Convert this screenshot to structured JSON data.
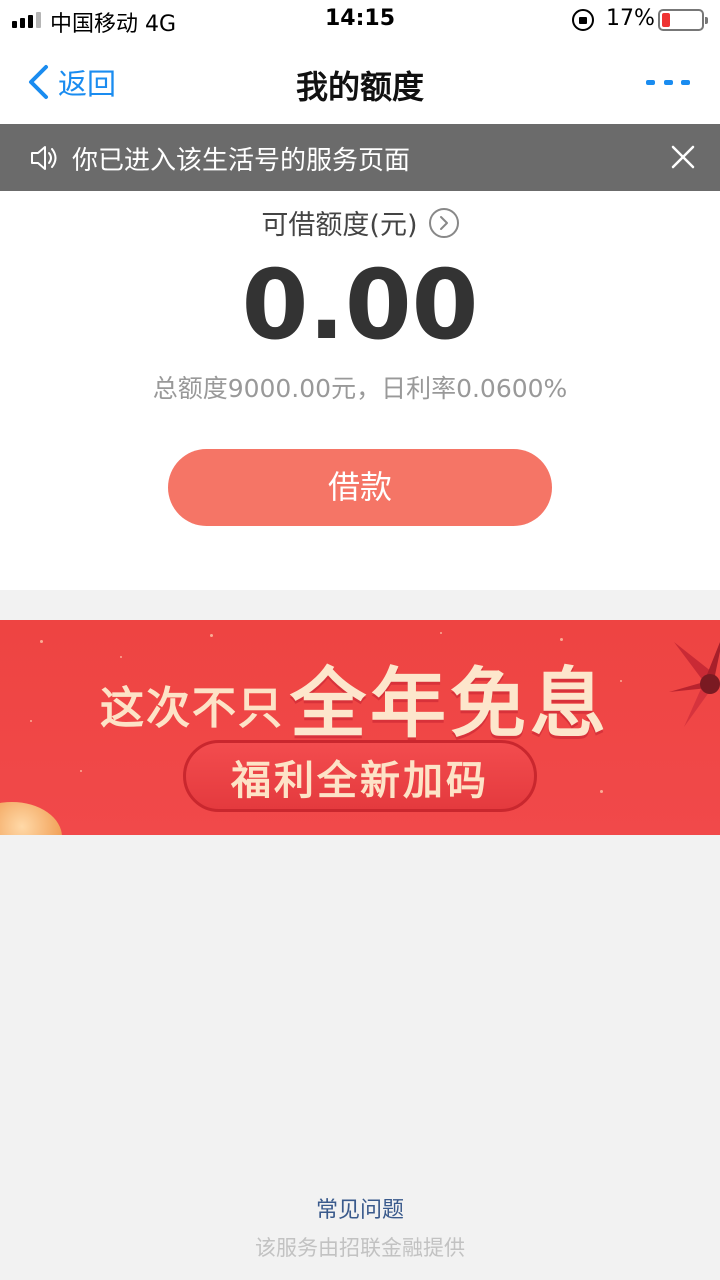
{
  "status_bar": {
    "carrier": "中国移动   4G",
    "time": "14:15",
    "battery_percent": "17%",
    "battery_level": 0.17,
    "signal_bars": 3
  },
  "nav": {
    "back_label": "返回",
    "title": "我的额度",
    "accent_color": "#1a8cf0"
  },
  "notice": {
    "text": "你已进入该生活号的服务页面"
  },
  "quota": {
    "label": "可借额度(元)",
    "amount": "0.00",
    "detail": "总额度9000.00元，日利率0.0600%",
    "borrow_label": "借款",
    "button_color": "#f57566"
  },
  "banner": {
    "lead": "这次不只",
    "headline": "全年免息",
    "sub": "福利全新加码",
    "background_color": "#ee4442"
  },
  "footer": {
    "faq_label": "常见问题",
    "provider_note": "该服务由招联金融提供"
  },
  "icons": {
    "back": "chevron-left-icon",
    "more": "more-dots-icon",
    "speaker": "speaker-icon",
    "close": "close-icon",
    "info": "chevron-right-circle-icon"
  }
}
